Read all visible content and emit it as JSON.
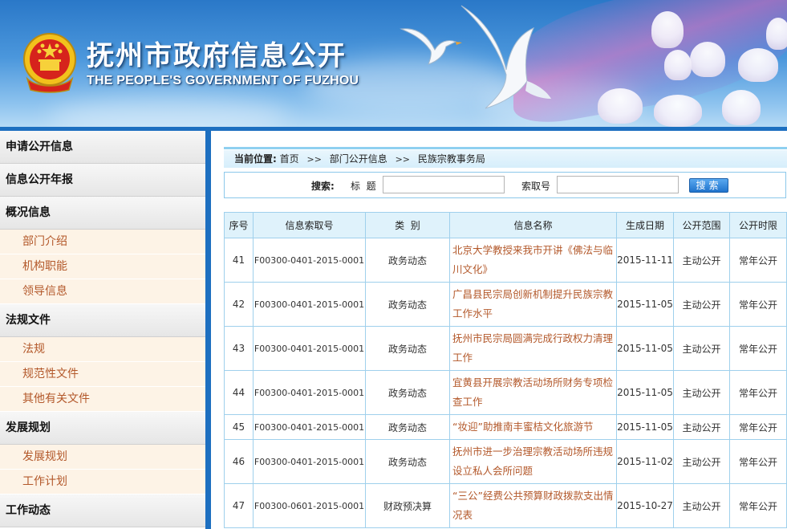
{
  "header": {
    "title_cn": "抚州市政府信息公开",
    "title_en": "THE PEOPLE'S GOVERNMENT OF FUZHOU"
  },
  "sidebar": {
    "sections": [
      {
        "label": "申请公开信息",
        "items": []
      },
      {
        "label": "信息公开年报",
        "items": []
      },
      {
        "label": "概况信息",
        "items": [
          "部门介绍",
          "机构职能",
          "领导信息"
        ]
      },
      {
        "label": "法规文件",
        "items": [
          "法规",
          "规范性文件",
          "其他有关文件"
        ]
      },
      {
        "label": "发展规划",
        "items": [
          "发展规划",
          "工作计划"
        ]
      },
      {
        "label": "工作动态",
        "items": []
      }
    ]
  },
  "breadcrumb": {
    "label": "当前位置:",
    "items": [
      "首页",
      "部门公开信息",
      "民族宗教事务局"
    ],
    "separator": ">>"
  },
  "search": {
    "label": "搜索:",
    "title_label": "标  题",
    "title_value": "",
    "index_label": "索取号",
    "index_value": "",
    "button": "搜索"
  },
  "table": {
    "headers": [
      "序号",
      "信息索取号",
      "类  别",
      "信息名称",
      "生成日期",
      "公开范围",
      "公开时限"
    ],
    "rows": [
      {
        "no": "41",
        "index": "F00300-0401-2015-0001",
        "category": "政务动态",
        "name": "北京大学教授来我市开讲《佛法与临川文化》",
        "date": "2015-11-11",
        "scope": "主动公开",
        "limit": "常年公开"
      },
      {
        "no": "42",
        "index": "F00300-0401-2015-0001",
        "category": "政务动态",
        "name": "广昌县民宗局创新机制提升民族宗教工作水平",
        "date": "2015-11-05",
        "scope": "主动公开",
        "limit": "常年公开"
      },
      {
        "no": "43",
        "index": "F00300-0401-2015-0001",
        "category": "政务动态",
        "name": "抚州市民宗局圆满完成行政权力清理工作",
        "date": "2015-11-05",
        "scope": "主动公开",
        "limit": "常年公开"
      },
      {
        "no": "44",
        "index": "F00300-0401-2015-0001",
        "category": "政务动态",
        "name": "宜黄县开展宗教活动场所财务专项检查工作",
        "date": "2015-11-05",
        "scope": "主动公开",
        "limit": "常年公开"
      },
      {
        "no": "45",
        "index": "F00300-0401-2015-0001",
        "category": "政务动态",
        "name": "“妆迎”助推南丰蜜桔文化旅游节",
        "date": "2015-11-05",
        "scope": "主动公开",
        "limit": "常年公开"
      },
      {
        "no": "46",
        "index": "F00300-0401-2015-0001",
        "category": "政务动态",
        "name": "抚州市进一步治理宗教活动场所违规设立私人会所问题",
        "date": "2015-11-02",
        "scope": "主动公开",
        "limit": "常年公开"
      },
      {
        "no": "47",
        "index": "F00300-0601-2015-0001",
        "category": "财政预决算",
        "name": "“三公”经费公共预算财政拨款支出情况表",
        "date": "2015-10-27",
        "scope": "主动公开",
        "limit": "常年公开"
      }
    ]
  }
}
